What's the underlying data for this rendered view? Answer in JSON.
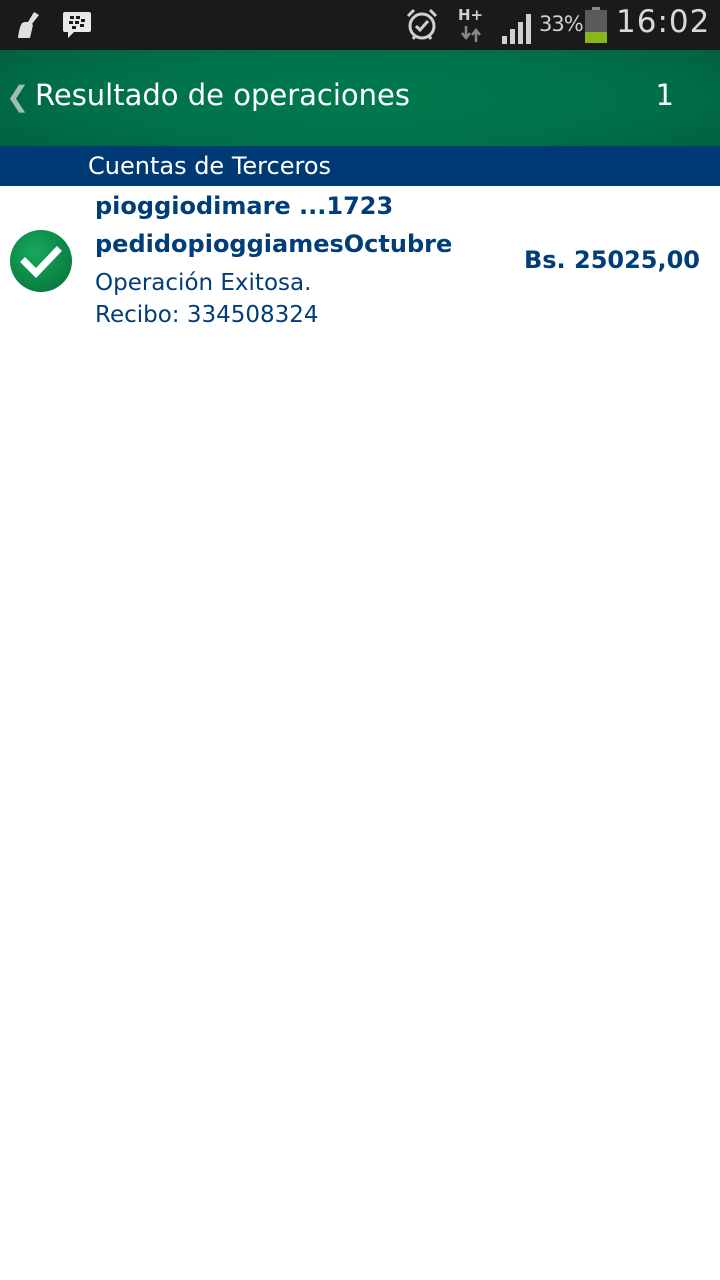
{
  "status_bar": {
    "left_icons": [
      "broom-icon",
      "bbm-icon"
    ],
    "right_icons": [
      "alarm-icon",
      "h-plus-network-icon",
      "signal-icon",
      "battery-icon"
    ],
    "network_type": "H+",
    "battery_percent": "33%",
    "battery_level": 0.33,
    "time": "16:02"
  },
  "header": {
    "back_glyph": "❮",
    "title": "Resultado de operaciones",
    "count": "1"
  },
  "section": {
    "title": "Cuentas de Terceros"
  },
  "operations": [
    {
      "status_icon": "check-circle-icon",
      "account": "pioggiodimare ...1723",
      "description": "pedidopioggiamesOctubre",
      "status": "Operación Exitosa.",
      "receipt": "Recibo: 334508324",
      "amount": "Bs. 25025,00"
    }
  ],
  "colors": {
    "status_bar_bg": "#1a1a1a",
    "header_green": "#007a4e",
    "section_blue": "#003a75",
    "text_blue": "#003d79",
    "check_green": "#0a8a4a",
    "battery_fill": "#8ab61f"
  }
}
